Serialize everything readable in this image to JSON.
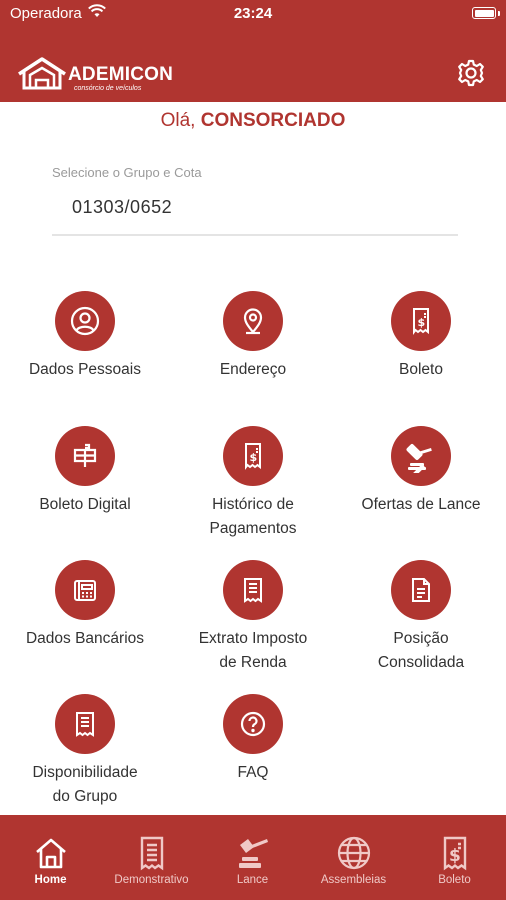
{
  "status_bar": {
    "carrier": "Operadora",
    "time": "23:24"
  },
  "header": {
    "logo_name": "ADEMICON",
    "logo_tagline": "consórcio de veículos"
  },
  "greeting": {
    "prefix": "Olá,",
    "name": "CONSORCIADO"
  },
  "group_select": {
    "label": "Selecione o Grupo e Cota",
    "value": "01303/0652"
  },
  "menu": [
    {
      "label": "Dados Pessoais",
      "icon": "user-icon"
    },
    {
      "label": "Endereço",
      "icon": "location-pin-icon"
    },
    {
      "label": "Boleto",
      "icon": "receipt-dollar-icon"
    },
    {
      "label": "Boleto Digital",
      "icon": "mailbox-icon"
    },
    {
      "label": "Histórico de\nPagamentos",
      "icon": "receipt-dollar-icon"
    },
    {
      "label": "Ofertas de Lance",
      "icon": "gavel-icon"
    },
    {
      "label": "Dados Bancários",
      "icon": "bank-card-icon"
    },
    {
      "label": "Extrato Imposto\nde Renda",
      "icon": "statement-icon"
    },
    {
      "label": "Posição\nConsolidada",
      "icon": "document-icon"
    },
    {
      "label": "Disponibilidade\ndo Grupo",
      "icon": "statement-icon"
    },
    {
      "label": "FAQ",
      "icon": "question-icon"
    }
  ],
  "tabs": [
    {
      "label": "Home",
      "icon": "home-icon",
      "active": true
    },
    {
      "label": "Demonstrativo",
      "icon": "statement-icon",
      "active": false
    },
    {
      "label": "Lance",
      "icon": "gavel-icon",
      "active": false
    },
    {
      "label": "Assembleias",
      "icon": "globe-icon",
      "active": false
    },
    {
      "label": "Boleto",
      "icon": "receipt-dollar-icon",
      "active": false
    }
  ],
  "colors": {
    "brand": "#b03530",
    "background": "#ffffff",
    "text": "#333333",
    "muted": "#9a9a9a"
  }
}
